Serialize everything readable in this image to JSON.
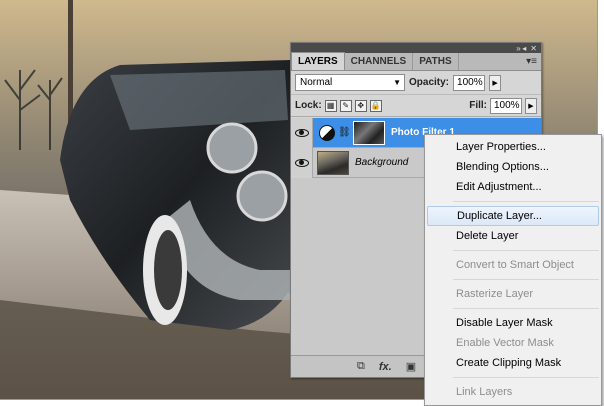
{
  "panel": {
    "topbar": {
      "collapse_icon": "» ◂",
      "close_icon": "✕"
    },
    "tabs": [
      {
        "label": "LAYERS",
        "active": true
      },
      {
        "label": "CHANNELS",
        "active": false
      },
      {
        "label": "PATHS",
        "active": false
      }
    ],
    "menu_icon": "▾≡",
    "blend_mode": "Normal",
    "opacity_label": "Opacity:",
    "opacity_value": "100%",
    "lock_label": "Lock:",
    "fill_label": "Fill:",
    "fill_value": "100%",
    "layers": [
      {
        "name": "Photo Filter 1",
        "selected": true
      },
      {
        "name": "Background",
        "selected": false
      }
    ],
    "bottom": {
      "link": "⧉",
      "fx": "fx.",
      "mask": "▣"
    }
  },
  "context_menu": {
    "items": [
      {
        "label": "Layer Properties...",
        "enabled": true
      },
      {
        "label": "Blending Options...",
        "enabled": true
      },
      {
        "label": "Edit Adjustment...",
        "enabled": true
      },
      {
        "label": "Duplicate Layer...",
        "enabled": true,
        "hover": true
      },
      {
        "label": "Delete Layer",
        "enabled": true
      },
      {
        "label": "Convert to Smart Object",
        "enabled": false
      },
      {
        "label": "Rasterize Layer",
        "enabled": false
      },
      {
        "label": "Disable Layer Mask",
        "enabled": true
      },
      {
        "label": "Enable Vector Mask",
        "enabled": false
      },
      {
        "label": "Create Clipping Mask",
        "enabled": true
      },
      {
        "label": "Link Layers",
        "enabled": false
      }
    ]
  },
  "colors": {
    "selection_blue": "#3c8ee6",
    "menu_hover": "#dce8f8"
  }
}
